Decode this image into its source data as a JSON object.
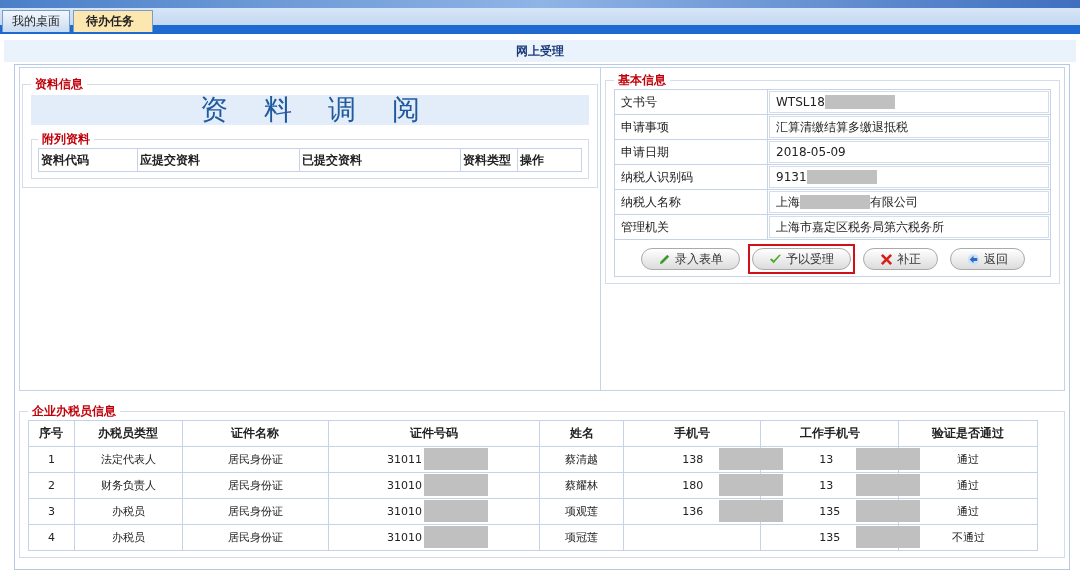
{
  "tabs": [
    {
      "label": "我的桌面",
      "selected": false
    },
    {
      "label": "待办任务",
      "selected": true
    }
  ],
  "page_title": "网上受理",
  "material_info": {
    "legend": "资料信息",
    "banner": [
      "资",
      "料",
      "调",
      "阅"
    ],
    "attached": {
      "legend": "附列资料",
      "columns": [
        "资料代码",
        "应提交资料",
        "已提交资料",
        "资料类型",
        "操作"
      ]
    }
  },
  "basic_info": {
    "legend": "基本信息",
    "fields": [
      {
        "label": "文书号",
        "parts": [
          {
            "text": "WTSL18"
          },
          {
            "redacted": true
          }
        ]
      },
      {
        "label": "申请事项",
        "parts": [
          {
            "text": "汇算清缴结算多缴退抵税"
          }
        ]
      },
      {
        "label": "申请日期",
        "parts": [
          {
            "text": "2018-05-09"
          }
        ]
      },
      {
        "label": "纳税人识别码",
        "parts": [
          {
            "text": "9131"
          },
          {
            "redacted": true
          }
        ]
      },
      {
        "label": "纳税人名称",
        "parts": [
          {
            "text": "上海"
          },
          {
            "redacted": true
          },
          {
            "text": "有限公司"
          }
        ]
      },
      {
        "label": "管理机关",
        "parts": [
          {
            "text": "上海市嘉定区税务局第六税务所"
          }
        ]
      }
    ],
    "buttons": [
      {
        "kind": "edit",
        "label": "录入表单",
        "highlighted": false
      },
      {
        "kind": "accept",
        "label": "予以受理",
        "highlighted": true
      },
      {
        "kind": "reject",
        "label": "补正",
        "highlighted": false
      },
      {
        "kind": "back",
        "label": "返回",
        "highlighted": false
      }
    ]
  },
  "tax_staff": {
    "legend": "企业办税员信息",
    "columns": [
      "序号",
      "办税员类型",
      "证件名称",
      "证件号码",
      "姓名",
      "手机号",
      "工作手机号",
      "验证是否通过"
    ],
    "rows": [
      [
        {
          "text": "1"
        },
        {
          "text": "法定代表人"
        },
        {
          "text": "居民身份证"
        },
        {
          "text": "31011",
          "redacted": true
        },
        {
          "text": "蔡清越"
        },
        {
          "text": "138",
          "redacted": true
        },
        {
          "text": "13",
          "redacted": true
        },
        {
          "text": "通过"
        }
      ],
      [
        {
          "text": "2"
        },
        {
          "text": "财务负责人"
        },
        {
          "text": "居民身份证"
        },
        {
          "text": "31010",
          "redacted": true
        },
        {
          "text": "蔡耀林"
        },
        {
          "text": "180",
          "redacted": true
        },
        {
          "text": "13",
          "redacted": true
        },
        {
          "text": "通过"
        }
      ],
      [
        {
          "text": "3"
        },
        {
          "text": "办税员"
        },
        {
          "text": "居民身份证"
        },
        {
          "text": "31010",
          "redacted": true
        },
        {
          "text": "项观莲"
        },
        {
          "text": "136",
          "redacted": true
        },
        {
          "text": "135",
          "redacted": true
        },
        {
          "text": "通过"
        }
      ],
      [
        {
          "text": "4"
        },
        {
          "text": "办税员"
        },
        {
          "text": "居民身份证"
        },
        {
          "text": "31010",
          "redacted": true
        },
        {
          "text": "项冠莲"
        },
        {
          "redacted": false
        },
        {
          "text": "135",
          "redacted": true
        },
        {
          "text": "不通过"
        }
      ]
    ]
  }
}
